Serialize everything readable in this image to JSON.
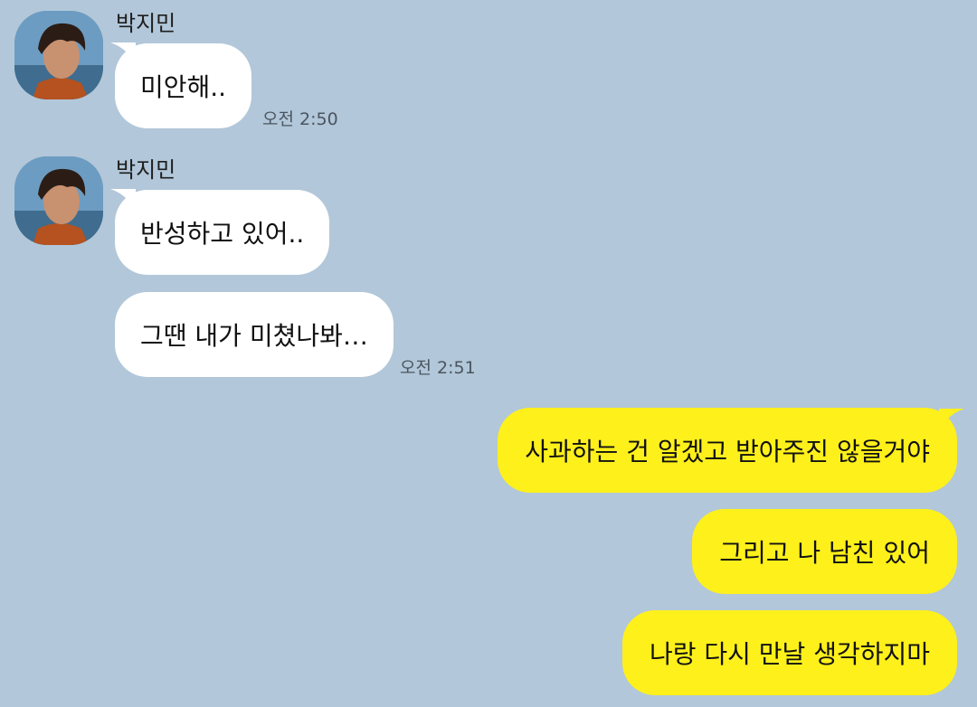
{
  "colors": {
    "background": "#b2c7d9",
    "incoming_bubble": "#ffffff",
    "outgoing_bubble": "#fef01b"
  },
  "groups": [
    {
      "sender": "박지민",
      "messages": [
        "미안해.."
      ],
      "time": "오전 2:50"
    },
    {
      "sender": "박지민",
      "messages": [
        "반성하고 있어..",
        "그땐 내가 미쳤나봐…"
      ],
      "time": "오전 2:51"
    }
  ],
  "outgoing": {
    "messages": [
      "사과하는 건 알겠고 받아주진 않을거야",
      "그리고 나 남친 있어",
      "나랑 다시 만날 생각하지마"
    ]
  }
}
